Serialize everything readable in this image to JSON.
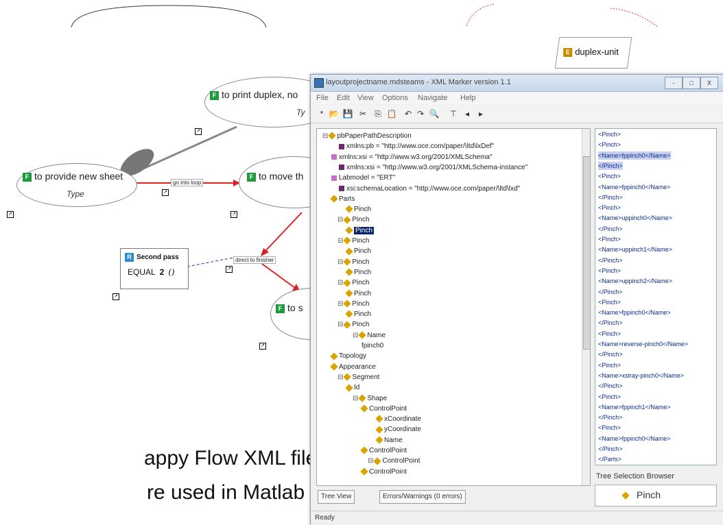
{
  "diagram": {
    "nodes": {
      "print_duplex": {
        "badge": "F",
        "title": "to print duplex, no",
        "sub": "Ty"
      },
      "new_sheet": {
        "badge": "F",
        "title": "to provide new sheet",
        "sub": "Type"
      },
      "move": {
        "badge": "F",
        "title": "to move th"
      },
      "to_s": {
        "badge": "F",
        "title": "to s"
      },
      "duplex_unit": {
        "badge": "E",
        "title": "duplex-unit"
      }
    },
    "edges": {
      "go_into_loop": "go into loop",
      "direct_to_finisher": "direct to finisher"
    },
    "rule": {
      "badge": "R",
      "title": "Second pass",
      "op": "EQUAL",
      "value": "2",
      "paren": "()"
    },
    "caption": {
      "line1": "appy Flow XML files",
      "line2": "re used in Matlab"
    }
  },
  "window": {
    "title": "layoutprojectname.mdsteams - XML Marker version 1.1",
    "menu": [
      "File",
      "Edit",
      "View",
      "Options",
      "Navigate",
      "Help"
    ],
    "controls": {
      "min": "-",
      "max": "□",
      "close": "X"
    },
    "tree": [
      {
        "text": "pbPaperPathDescription",
        "icon": "diamond",
        "indent": 0
      },
      {
        "text": "xmlns:pb = \"http://www.oce.com/paper/\\ltd\\lxDef\"",
        "icon": "attr",
        "indent": 2
      },
      {
        "text": "xmlns:xsi = \"http://www.w3.org/2001/XMLSchema\"",
        "icon": "ns",
        "indent": 1
      },
      {
        "text": "xmlns:xsi = \"http://www.w3.org/2001/XMLSchema-instance\"",
        "icon": "attr",
        "indent": 2
      },
      {
        "text": "Labmodel = \"ERT\"",
        "icon": "ns",
        "indent": 1
      },
      {
        "text": "xsi:schemaLocation = \"http://www.oce.com/paper/\\ltd\\lxd\"",
        "icon": "attr",
        "indent": 2
      },
      {
        "text": "Parts",
        "icon": "diamond",
        "indent": 1
      },
      {
        "text": "Pinch",
        "icon": "diamond",
        "indent": 3
      },
      {
        "text": "Pinch",
        "icon": "diamond",
        "indent": 2
      },
      {
        "text": "Pinch",
        "icon": "diamond",
        "indent": 3,
        "selected": true
      },
      {
        "text": "Pinch",
        "icon": "diamond",
        "indent": 2
      },
      {
        "text": "Pinch",
        "icon": "diamond",
        "indent": 3
      },
      {
        "text": "Pinch",
        "icon": "diamond",
        "indent": 2
      },
      {
        "text": "Pinch",
        "icon": "diamond",
        "indent": 3
      },
      {
        "text": "Pinch",
        "icon": "diamond",
        "indent": 2
      },
      {
        "text": "Pinch",
        "icon": "diamond",
        "indent": 3
      },
      {
        "text": "Pinch",
        "icon": "diamond",
        "indent": 2
      },
      {
        "text": "Pinch",
        "icon": "diamond",
        "indent": 3
      },
      {
        "text": "Pinch",
        "icon": "diamond",
        "indent": 2
      },
      {
        "text": "Name",
        "icon": "diamond",
        "indent": 4
      },
      {
        "text": "fpinch0",
        "icon": "none",
        "indent": 5
      },
      {
        "text": "Topology",
        "icon": "diamond",
        "indent": 1
      },
      {
        "text": "Appearance",
        "icon": "diamond",
        "indent": 1
      },
      {
        "text": "Segment",
        "icon": "diamond",
        "indent": 2
      },
      {
        "text": "Id",
        "icon": "diamond",
        "indent": 3
      },
      {
        "text": "Shape",
        "icon": "diamond",
        "indent": 4
      },
      {
        "text": "ControlPoint",
        "icon": "diamond",
        "indent": 5
      },
      {
        "text": "xCoordinate",
        "icon": "diamond",
        "indent": 7
      },
      {
        "text": "yCoordinate",
        "icon": "diamond",
        "indent": 7
      },
      {
        "text": "Name",
        "icon": "diamond",
        "indent": 7
      },
      {
        "text": "ControlPoint",
        "icon": "diamond",
        "indent": 5
      },
      {
        "text": "ControlPoint",
        "icon": "diamond",
        "indent": 6
      },
      {
        "text": "ControlPoint",
        "icon": "diamond",
        "indent": 5
      }
    ],
    "text_lines": [
      {
        "text": "<Pinch>"
      },
      {
        "text": "<Pinch>"
      },
      {
        "text": "<Name>fppinch0</Name>",
        "hl": true
      },
      {
        "text": "</Pinch>",
        "hl": true
      },
      {
        "text": "<Pinch>"
      },
      {
        "text": "<Name>fppinch0</Name>"
      },
      {
        "text": "</Pinch>"
      },
      {
        "text": "<Pinch>"
      },
      {
        "text": "<Name>uppinch0</Name>"
      },
      {
        "text": "</Pinch>"
      },
      {
        "text": "<Pinch>"
      },
      {
        "text": "<Name>uppinch1</Name>"
      },
      {
        "text": "</Pinch>"
      },
      {
        "text": "<Pinch>"
      },
      {
        "text": "<Name>uppinch2</Name>"
      },
      {
        "text": "</Pinch>"
      },
      {
        "text": "<Pinch>"
      },
      {
        "text": "<Name>fppinch0</Name>"
      },
      {
        "text": "</Pinch>"
      },
      {
        "text": "<Pinch>"
      },
      {
        "text": "<Name>reverse-pinch0</Name>"
      },
      {
        "text": "</Pinch>"
      },
      {
        "text": "<Pinch>"
      },
      {
        "text": "<Name>xstray-pinch0</Name>"
      },
      {
        "text": "</Pinch>"
      },
      {
        "text": "<Pinch>"
      },
      {
        "text": "<Name>fppinch1</Name>"
      },
      {
        "text": "</Pinch>"
      },
      {
        "text": "<Pinch>"
      },
      {
        "text": "<Name>fppinch0</Name>"
      },
      {
        "text": "</Pinch>"
      },
      {
        "text": "</Parts>"
      }
    ],
    "tabs": [
      "Tree View",
      "Errors/Warnings (0 errors)"
    ],
    "browser_label": "Tree Selection Browser",
    "browser_value": "Pinch",
    "status": "Ready"
  }
}
